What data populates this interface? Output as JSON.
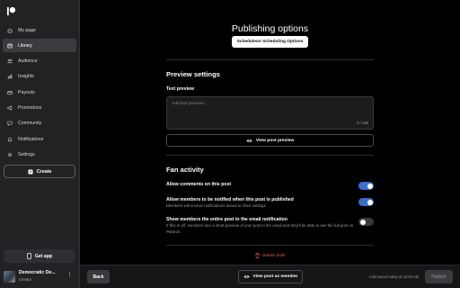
{
  "sidebar": {
    "logo_icon": "patreon-logo-icon",
    "items": [
      {
        "label": "My page",
        "icon": "user-icon",
        "active": false
      },
      {
        "label": "Library",
        "icon": "library-icon",
        "active": true
      },
      {
        "label": "Audience",
        "icon": "audience-icon",
        "active": false
      },
      {
        "label": "Insights",
        "icon": "insights-icon",
        "active": false
      },
      {
        "label": "Payouts",
        "icon": "payouts-icon",
        "active": false
      },
      {
        "label": "Promotions",
        "icon": "promotions-icon",
        "active": false
      },
      {
        "label": "Community",
        "icon": "community-icon",
        "active": false
      },
      {
        "label": "Notifications",
        "icon": "bell-icon",
        "active": false
      },
      {
        "label": "Settings",
        "icon": "gear-icon",
        "active": false
      }
    ],
    "create_label": "Create",
    "get_app_label": "Get app",
    "profile": {
      "name": "Democratic De...",
      "role": "Creator"
    }
  },
  "main": {
    "title": "Publishing options",
    "schedule_label": "Scheduleon Scheduling Options",
    "preview_settings": {
      "title": "Preview settings",
      "text_preview_label": "Text preview",
      "text_preview_placeholder": "Add text preview...",
      "char_count": "0 / 140",
      "view_preview_label": "View post preview"
    },
    "fan_activity": {
      "title": "Fan activity",
      "options": [
        {
          "label": "Allow comments on this post",
          "description": "",
          "enabled": true
        },
        {
          "label": "Allow members to be notified when this post is published",
          "description": "Members will receive notifications based on their settings",
          "enabled": true
        },
        {
          "label": "Show members the entire post in the email notification",
          "description": "If this is off, members see a short preview of your post in the email and they'll be able to see the full post on Patreon.",
          "enabled": false
        }
      ]
    },
    "delete_label": "Delete draft"
  },
  "bottombar": {
    "back_label": "Back",
    "view_as_member_label": "View post as member",
    "last_saved": "Last saved today at 12:06 AM",
    "publish_label": "Publish"
  },
  "colors": {
    "toggle_on": "#3b6fc9",
    "danger": "#e5585e",
    "sidebar_bg": "#222225"
  }
}
